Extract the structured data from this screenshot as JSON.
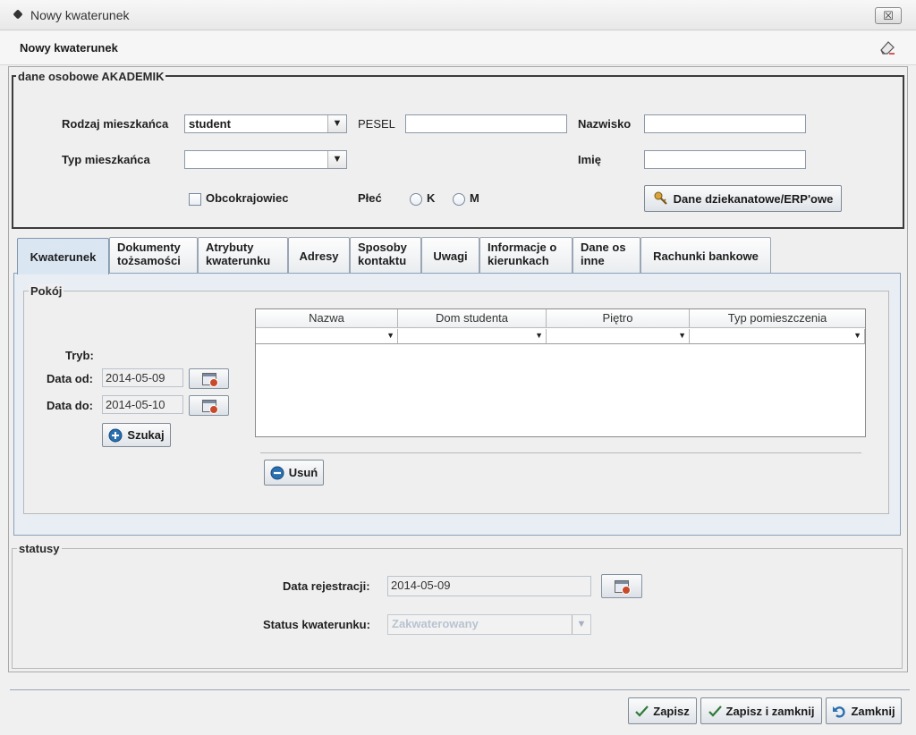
{
  "window": {
    "title": "Nowy kwaterunek",
    "close_label": "☒"
  },
  "header": {
    "title": "Nowy kwaterunek"
  },
  "personal": {
    "legend": "dane osobowe AKADEMIK",
    "rodzaj_label": "Rodzaj mieszkańca",
    "rodzaj_value": "student",
    "typ_label": "Typ mieszkańca",
    "typ_value": "",
    "pesel_label": "PESEL",
    "pesel_value": "",
    "nazwisko_label": "Nazwisko",
    "nazwisko_value": "",
    "imie_label": "Imię",
    "imie_value": "",
    "obcokrajowiec_label": "Obcokrajowiec",
    "plec_label": "Płeć",
    "plec_k": "K",
    "plec_m": "M",
    "dane_button": "Dane dziekanatowe/ERP'owe"
  },
  "tabs": [
    {
      "line1": "Kwaterunek",
      "line2": ""
    },
    {
      "line1": "Dokumenty",
      "line2": "tożsamości"
    },
    {
      "line1": "Atrybuty",
      "line2": "kwaterunku"
    },
    {
      "line1": "Adresy",
      "line2": ""
    },
    {
      "line1": "Sposoby",
      "line2": "kontaktu"
    },
    {
      "line1": "Uwagi",
      "line2": ""
    },
    {
      "line1": "Informacje o",
      "line2": "kierunkach"
    },
    {
      "line1": "Dane os",
      "line2": "inne"
    },
    {
      "line1": "Rachunki bankowe",
      "line2": ""
    }
  ],
  "room": {
    "legend": "Pokój",
    "tryb_label": "Tryb:",
    "data_od_label": "Data od:",
    "data_od_value": "2014-05-09",
    "data_do_label": "Data do:",
    "data_do_value": "2014-05-10",
    "szukaj_button": "Szukaj",
    "usun_button": "Usuń",
    "columns": [
      "Nazwa",
      "Dom studenta",
      "Piętro",
      "Typ pomieszczenia"
    ]
  },
  "status": {
    "legend": "statusy",
    "rejestracja_label": "Data rejestracji:",
    "rejestracja_value": "2014-05-09",
    "status_label": "Status kwaterunku:",
    "status_value": "Zakwaterowany"
  },
  "footer": {
    "zapisz": "Zapisz",
    "zapisz_zamknij": "Zapisz i zamknij",
    "zamknij": "Zamknij"
  },
  "colors": {
    "accent_tab": "#dbe6f3",
    "check": "#2f7a3a",
    "plus": "#2a6fb0"
  }
}
